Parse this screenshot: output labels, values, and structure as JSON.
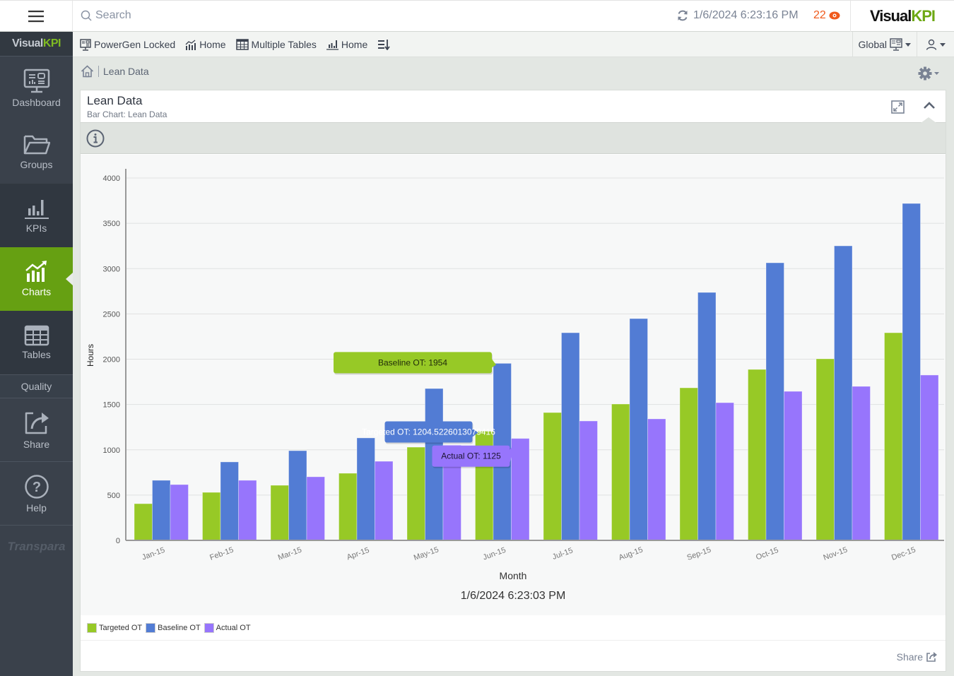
{
  "topbar": {
    "search_placeholder": "Search",
    "timestamp": "1/6/2024 6:23:16 PM",
    "alert_count": "22",
    "brand_visual": "Visual",
    "brand_kpi": "KPI"
  },
  "sidebar": {
    "logo_visual": "Visual",
    "logo_kpi": "KPI",
    "items": [
      {
        "label": "Dashboard",
        "icon": "dashboard-icon"
      },
      {
        "label": "Groups",
        "icon": "folder-icon"
      },
      {
        "label": "KPIs",
        "icon": "bar-chart-icon"
      },
      {
        "label": "Charts",
        "icon": "chart-trend-icon",
        "active": true
      },
      {
        "label": "Tables",
        "icon": "table-icon"
      },
      {
        "label": "Quality",
        "icon": ""
      },
      {
        "label": "Share",
        "icon": "share-icon"
      },
      {
        "label": "Help",
        "icon": "help-icon"
      }
    ],
    "footer_logo": "Transpara"
  },
  "navbar": {
    "links": [
      {
        "label": "PowerGen Locked",
        "icon": "dashboard-icon"
      },
      {
        "label": "Home",
        "icon": "chart-trend-icon"
      },
      {
        "label": "Multiple Tables",
        "icon": "table-icon"
      },
      {
        "label": "Home",
        "icon": "bar-chart-icon"
      }
    ],
    "global_label": "Global"
  },
  "breadcrumb": {
    "current": "Lean Data"
  },
  "panel": {
    "title": "Lean Data",
    "subtitle": "Bar Chart: Lean Data",
    "share_label": "Share"
  },
  "colors": {
    "accent_green": "#66a012",
    "targeted": "#97c926",
    "baseline": "#527cd4",
    "actual": "#9775fc",
    "alert": "#f05a1c"
  },
  "chart_data": {
    "type": "bar",
    "title": "",
    "xlabel": "Month",
    "ylabel": "Hours",
    "timestamp": "1/6/2024 6:23:03 PM",
    "ylim": [
      0,
      4000
    ],
    "yticks": [
      0,
      500,
      1000,
      1500,
      2000,
      2500,
      3000,
      3500,
      4000
    ],
    "grid": true,
    "legend_position": "bottom-left",
    "categories": [
      "Jan-15",
      "Feb-15",
      "Mar-15",
      "Apr-15",
      "May-15",
      "Jun-15",
      "Jul-15",
      "Aug-15",
      "Sep-15",
      "Oct-15",
      "Nov-15",
      "Dec-15"
    ],
    "series": [
      {
        "name": "Targeted OT",
        "color": "#97c926",
        "values": [
          405,
          530,
          608,
          741,
          1029,
          1204.5226013079416,
          1411,
          1505,
          1684,
          1887,
          2004,
          2292
        ]
      },
      {
        "name": "Baseline OT",
        "color": "#527cd4",
        "values": [
          663,
          866,
          990,
          1131,
          1676,
          1954,
          2292,
          2448,
          2737,
          3064,
          3251,
          3719
        ]
      },
      {
        "name": "Actual OT",
        "color": "#9775fc",
        "values": [
          616,
          663,
          702,
          873,
          1050,
          1125,
          1318,
          1341,
          1520,
          1645,
          1700,
          1825
        ]
      }
    ],
    "tooltips": [
      {
        "series": 1,
        "category": 5,
        "text": "Baseline OT: 1954"
      },
      {
        "series": 0,
        "category": 5,
        "text": "Targeted OT: 1204.5226013079416"
      },
      {
        "series": 2,
        "category": 5,
        "text": "Actual OT: 1125"
      }
    ]
  }
}
